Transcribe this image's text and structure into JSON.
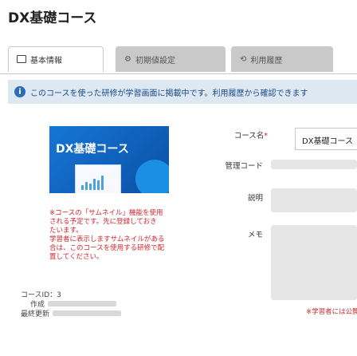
{
  "page": {
    "title": "DX基礎コース"
  },
  "tabs": {
    "basic": "基本情報",
    "init": "初期値設定",
    "history": "利用履歴"
  },
  "info": {
    "text": "このコースを使った研修が学習画面に掲載中です。利用履歴から確認できます"
  },
  "thumbnail": {
    "title": "DX基礎コース"
  },
  "course_note": "※コースの「サムネイル」機能を使用\nされる予定です。先に登録しておき\nたいます。\n学習者に表示しますサムネイルがある\n合は、このコースを使用する研修で配\n置してください。",
  "course_meta": {
    "id_label": "コースID：3",
    "created_label": "作成",
    "updated_label": "最終更新"
  },
  "form": {
    "name_label": "コース名",
    "name_required_mark": "*",
    "name_value": "DX基礎コース",
    "code_label": "管理コード",
    "description_label": "説明",
    "memo_label": "メモ",
    "memo_hint": "※学習者には公開されません"
  }
}
